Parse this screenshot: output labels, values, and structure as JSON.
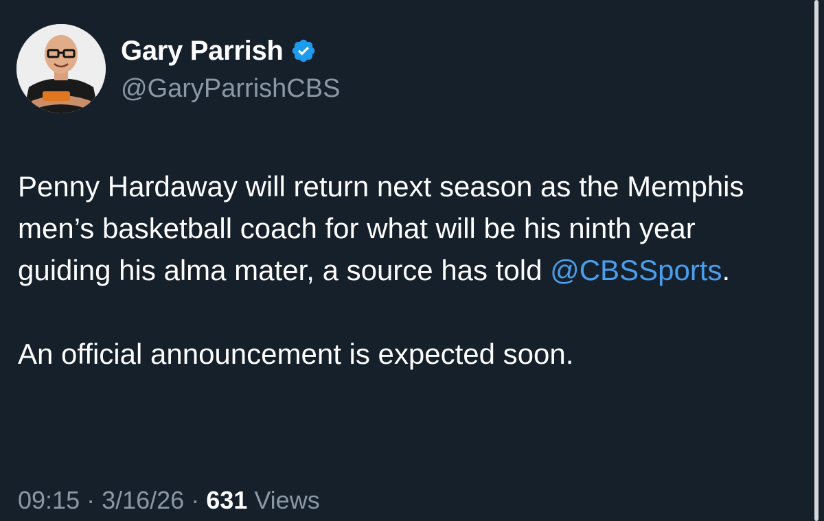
{
  "author": {
    "display_name": "Gary Parrish",
    "handle": "@GaryParrishCBS",
    "verified_icon": "verified-badge-icon",
    "verified_color": "#1d9bf0"
  },
  "tweet": {
    "text_before_mention": "Penny Hardaway will return next season as the Memphis men’s basketball coach for what will be his ninth year guiding his alma mater, a source has told ",
    "mention": "@CBSSports",
    "text_after_mention": ".",
    "second_paragraph": "An official announcement is expected soon.",
    "mention_color": "#4a9eeb"
  },
  "meta": {
    "time": "09:15",
    "separator": " · ",
    "date": "3/16/26",
    "views_count": "631",
    "views_label": "Views"
  },
  "colors": {
    "background": "#15202b",
    "secondary_text": "#8b98a5"
  }
}
